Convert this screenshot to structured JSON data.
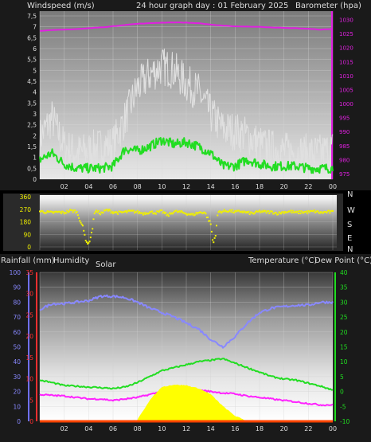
{
  "header": {
    "windspeed_label": "Windspeed (m/s)",
    "title": "24 hour graph day : 01 February 2025",
    "barometer_label": "Barometer (hpa)"
  },
  "x_ticks": [
    "02",
    "04",
    "06",
    "08",
    "10",
    "12",
    "14",
    "16",
    "18",
    "20",
    "22",
    "00"
  ],
  "chart_data": [
    {
      "type": "line",
      "x": [
        "00",
        "01",
        "02",
        "03",
        "04",
        "05",
        "06",
        "07",
        "08",
        "09",
        "10",
        "11",
        "12",
        "13",
        "14",
        "15",
        "16",
        "17",
        "18",
        "19",
        "20",
        "21",
        "22",
        "23",
        "00"
      ],
      "xlabel": "",
      "y_left_label": "Windspeed (m/s)",
      "y_left_ticks": [
        "0",
        "0,5",
        "1",
        "1,5",
        "2",
        "2,5",
        "3",
        "3,5",
        "4",
        "4,5",
        "5",
        "5,5",
        "6",
        "6,5",
        "7",
        "7,5"
      ],
      "ylim_left": [
        0,
        7.5
      ],
      "y_right_label": "Barometer (hpa)",
      "y_right_ticks": [
        "975",
        "980",
        "985",
        "990",
        "995",
        "1000",
        "1005",
        "1010",
        "1015",
        "1020",
        "1025",
        "1030"
      ],
      "ylim_right": [
        973,
        1033
      ],
      "series": [
        {
          "name": "",
          "role": "gust",
          "color": "#e0e0e0",
          "axis": "left",
          "values": [
            1.9,
            2.8,
            1.5,
            1.2,
            1.3,
            1.5,
            1.6,
            2.8,
            4.2,
            4.8,
            5.2,
            5.0,
            4.4,
            4.0,
            3.0,
            2.3,
            2.2,
            2.0,
            1.6,
            1.4,
            1.3,
            1.2,
            1.2,
            1.2,
            1.4
          ]
        },
        {
          "name": "",
          "role": "average",
          "color": "#22dd22",
          "axis": "left",
          "values": [
            0.9,
            1.2,
            0.7,
            0.5,
            0.5,
            0.5,
            0.6,
            1.4,
            1.3,
            1.5,
            1.8,
            1.6,
            1.7,
            1.5,
            1.2,
            0.6,
            0.6,
            0.9,
            0.7,
            0.6,
            0.6,
            0.6,
            0.5,
            0.5,
            0.5
          ]
        },
        {
          "name": "",
          "role": "barometer",
          "color": "#e020e0",
          "axis": "right",
          "values": [
            1026.0,
            1026.2,
            1026.4,
            1026.6,
            1026.9,
            1027.2,
            1027.6,
            1028.1,
            1028.5,
            1028.7,
            1028.9,
            1029.0,
            1028.9,
            1028.7,
            1028.2,
            1027.8,
            1027.6,
            1027.5,
            1027.4,
            1027.2,
            1027.0,
            1026.9,
            1026.7,
            1026.4,
            1026.6
          ]
        }
      ]
    },
    {
      "type": "scatter",
      "ylabel": "",
      "y_ticks": [
        "360",
        "270",
        "180",
        "90",
        "0"
      ],
      "ylim": [
        0,
        360
      ],
      "compass_labels": [
        "N",
        "W",
        "S",
        "E",
        "N"
      ],
      "series": [
        {
          "name": "",
          "role": "wind direction",
          "color": "#f0f000",
          "x": [
            0,
            0.5,
            1,
            1.5,
            2,
            2.5,
            3,
            3.5,
            3.8,
            4,
            4.3,
            4.5,
            5,
            5.5,
            6,
            6.5,
            7,
            7.5,
            8,
            8.5,
            9,
            9.5,
            10,
            10.5,
            11,
            11.5,
            12,
            12.5,
            13,
            13.5,
            14,
            14.2,
            14.4,
            14.6,
            15,
            15.5,
            16,
            16.5,
            17,
            17.5,
            18,
            18.5,
            19,
            19.5,
            20,
            20.5,
            21,
            21.5,
            22,
            22.5,
            23,
            23.5,
            24
          ],
          "values": [
            255,
            250,
            245,
            250,
            245,
            260,
            255,
            150,
            40,
            20,
            120,
            260,
            240,
            265,
            250,
            245,
            250,
            255,
            250,
            240,
            250,
            245,
            255,
            225,
            255,
            250,
            240,
            230,
            245,
            250,
            165,
            20,
            90,
            250,
            255,
            260,
            250,
            255,
            245,
            240,
            255,
            250,
            250,
            240,
            250,
            255,
            245,
            250,
            250,
            255,
            245,
            250,
            250
          ]
        }
      ]
    },
    {
      "type": "line",
      "labels": {
        "rainfall": "Rainfall (mm)",
        "humidity": "Humidity",
        "solar": "Solar",
        "temperature": "Temperature (°C)",
        "dewpoint": "Dew Point (°C)"
      },
      "humidity_ticks": [
        "0",
        "10",
        "20",
        "30",
        "40",
        "50",
        "60",
        "70",
        "80",
        "90",
        "100"
      ],
      "rain_ticks": [
        "0",
        "5",
        "10",
        "15",
        "20",
        "25",
        "30",
        "35"
      ],
      "temp_ticks": [
        "-10",
        "-5",
        "0",
        "5",
        "10",
        "15",
        "20",
        "25",
        "30",
        "35",
        "40"
      ],
      "ylim_humidity": [
        0,
        100
      ],
      "ylim_temp": [
        -10,
        40
      ],
      "x": [
        "00",
        "01",
        "02",
        "03",
        "04",
        "05",
        "06",
        "07",
        "08",
        "09",
        "10",
        "11",
        "12",
        "13",
        "14",
        "15",
        "16",
        "17",
        "18",
        "19",
        "20",
        "21",
        "22",
        "23",
        "00"
      ],
      "series": [
        {
          "name": "Humidity",
          "color": "#8888ff",
          "axis": "humidity",
          "values": [
            75,
            79,
            79,
            80,
            81,
            84,
            84,
            83,
            80,
            76,
            73,
            70,
            66,
            62,
            55,
            50,
            57,
            66,
            73,
            76,
            77,
            78,
            78,
            80,
            80
          ]
        },
        {
          "name": "Temperature (°C)",
          "color": "#22dd22",
          "axis": "temp",
          "values": [
            3.8,
            3.0,
            2.0,
            1.8,
            1.5,
            1.3,
            1.0,
            1.5,
            3.0,
            5.0,
            7.0,
            8.0,
            9.0,
            10.0,
            10.5,
            11.0,
            9.5,
            8.0,
            6.5,
            5.0,
            4.2,
            3.8,
            2.8,
            1.8,
            0.5
          ]
        },
        {
          "name": "Dew Point (°C)",
          "color": "#ff22ff",
          "axis": "temp",
          "values": [
            -1.0,
            -1.3,
            -1.5,
            -2.0,
            -2.5,
            -2.5,
            -3.0,
            -2.5,
            -2.0,
            -1.0,
            0.0,
            0.0,
            0.5,
            0.5,
            0.0,
            -0.5,
            -0.8,
            -1.5,
            -2.0,
            -2.5,
            -3.0,
            -3.5,
            -4.0,
            -4.5,
            -4.5
          ]
        },
        {
          "name": "Solar",
          "color": "#ffff00",
          "axis": "humidity",
          "fill": true,
          "values": [
            0,
            0,
            0,
            0,
            0,
            0,
            0,
            0,
            0.8,
            14.0,
            23.0,
            24.5,
            24.0,
            22.0,
            18.0,
            10.0,
            3.5,
            0,
            0,
            0,
            0,
            0,
            0,
            0,
            0
          ]
        },
        {
          "name": "Rainfall (mm)",
          "color": "#ff4400",
          "axis": "rain",
          "values": [
            0,
            0,
            0,
            0,
            0,
            0,
            0,
            0,
            0,
            0,
            0,
            0,
            0,
            0,
            0,
            0,
            0,
            0,
            0,
            0,
            0,
            0,
            0,
            0,
            0
          ]
        }
      ]
    }
  ]
}
